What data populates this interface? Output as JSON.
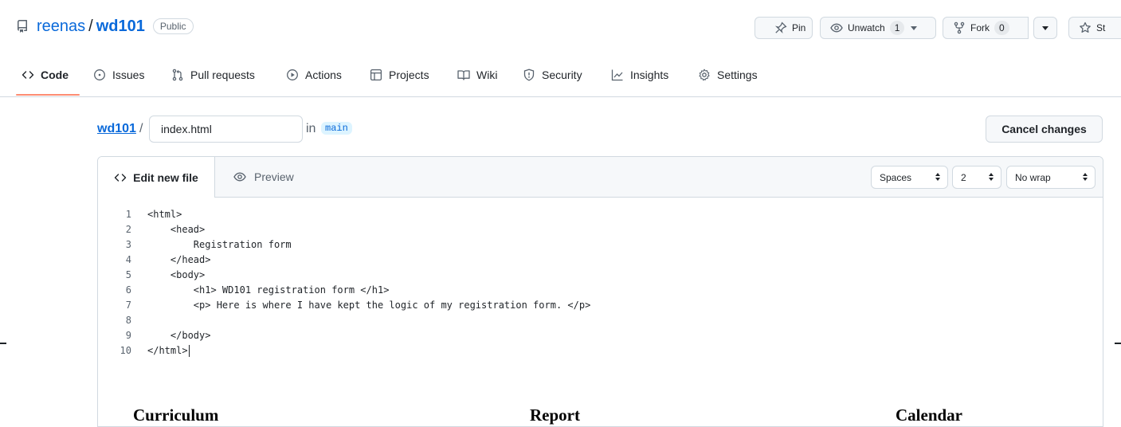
{
  "repo": {
    "owner": "reenas",
    "separator": "/",
    "name": "wd101",
    "visibility": "Public"
  },
  "actions": {
    "pin": "Pin",
    "unwatch": "Unwatch",
    "unwatch_count": "1",
    "fork": "Fork",
    "fork_count": "0",
    "star": "St"
  },
  "nav": {
    "tabs": [
      {
        "label": "Code",
        "icon": "code-icon",
        "selected": true
      },
      {
        "label": "Issues",
        "icon": "issue-icon"
      },
      {
        "label": "Pull requests",
        "icon": "pull-request-icon"
      },
      {
        "label": "Actions",
        "icon": "play-icon"
      },
      {
        "label": "Projects",
        "icon": "table-icon"
      },
      {
        "label": "Wiki",
        "icon": "book-icon"
      },
      {
        "label": "Security",
        "icon": "shield-icon"
      },
      {
        "label": "Insights",
        "icon": "graph-icon"
      },
      {
        "label": "Settings",
        "icon": "gear-icon"
      }
    ]
  },
  "breadcrumb": {
    "repo": "wd101",
    "slash": "/",
    "filename": "index.html",
    "in_label": "in",
    "branch": "main"
  },
  "cancel_label": "Cancel changes",
  "editor": {
    "edit_tab": "Edit new file",
    "preview_tab": "Preview",
    "indent_mode": "Spaces",
    "indent_size": "2",
    "wrap_mode": "No wrap",
    "lines": [
      {
        "n": "1",
        "text": "<html>"
      },
      {
        "n": "2",
        "text": "    <head>"
      },
      {
        "n": "3",
        "text": "        Registration form"
      },
      {
        "n": "4",
        "text": "    </head>"
      },
      {
        "n": "5",
        "text": "    <body>"
      },
      {
        "n": "6",
        "text": "        <h1> WD101 registration form </h1>"
      },
      {
        "n": "7",
        "text": "        <p> Here is where I have kept the logic of my registration form. </p>"
      },
      {
        "n": "8",
        "text": ""
      },
      {
        "n": "9",
        "text": "    </body>"
      },
      {
        "n": "10",
        "text": "</html>"
      }
    ]
  },
  "footer_words": {
    "left": "Curriculum",
    "middle": "Report",
    "right": "Calendar"
  },
  "colors": {
    "accent_link": "#0969da",
    "selected_tab_underline": "#fd8c73",
    "border": "#d1d9e0",
    "muted_text": "#59636e"
  }
}
